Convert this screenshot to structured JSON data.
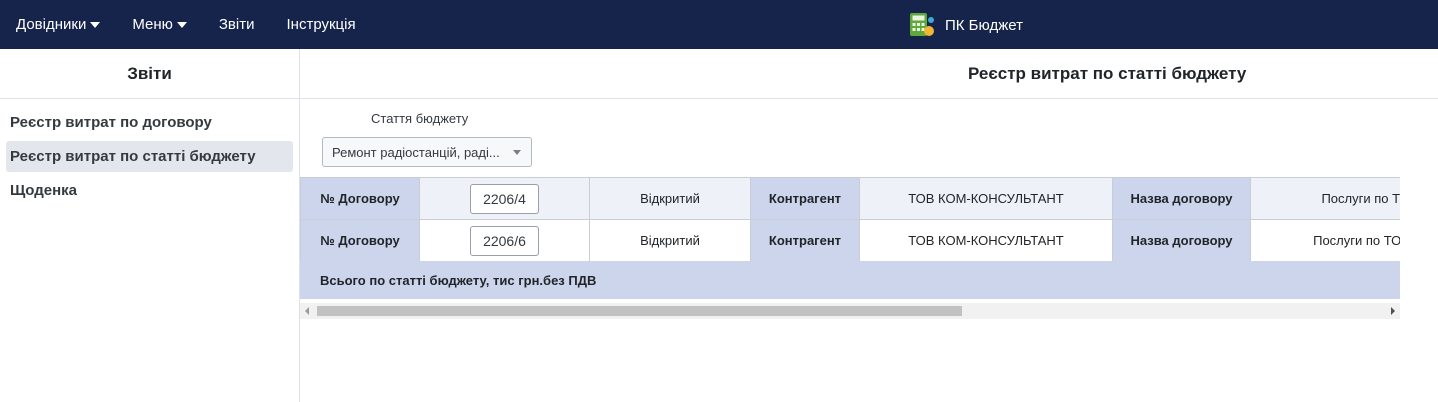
{
  "navbar": {
    "items": [
      {
        "label": "Довідники",
        "dropdown": true
      },
      {
        "label": "Меню",
        "dropdown": true
      },
      {
        "label": "Звіти",
        "dropdown": false
      },
      {
        "label": "Інструкція",
        "dropdown": false
      }
    ],
    "brand": "ПК Бюджет",
    "brand_icon": "calculator-icon",
    "background": "#16244b"
  },
  "sidebar": {
    "title": "Звіти",
    "items": [
      {
        "label": "Реєстр витрат по договору",
        "active": false
      },
      {
        "label": "Реєстр витрат по статті бюджету",
        "active": true
      },
      {
        "label": "Щоденка",
        "active": false
      }
    ]
  },
  "main": {
    "title": "Реєстр витрат по статті бюджету",
    "filter": {
      "label": "Стаття бюджету",
      "value": "Ремонт радіостанцій, раді..."
    },
    "rows": [
      {
        "contract_label": "№ Договору",
        "contract_no": "2206/4",
        "status": "Відкритий",
        "counterparty_label": "Контрагент",
        "counterparty": "ТОВ КОМ-КОНСУЛЬТАНТ",
        "contract_name_label": "Назва договору",
        "contract_name": "Послуги по ТО"
      },
      {
        "contract_label": "№ Договору",
        "contract_no": "2206/6",
        "status": "Відкритий",
        "counterparty_label": "Контрагент",
        "counterparty": "ТОВ КОМ-КОНСУЛЬТАНТ",
        "contract_name_label": "Назва договору",
        "contract_name": "Послуги по ТО та"
      }
    ],
    "total_label": "Всього по статті бюджету, тис грн.без ПДВ"
  },
  "colors": {
    "label_cell": "#ccd5ec",
    "active_sidebar": "#e4e6ee"
  }
}
